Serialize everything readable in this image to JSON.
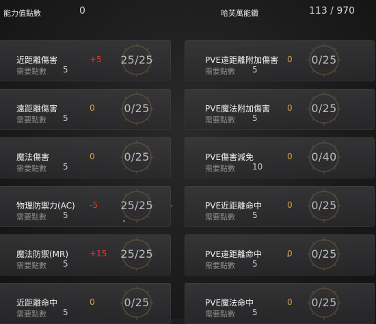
{
  "header": {
    "points_label": "能力值點數",
    "points_value": "0",
    "harvest_label": "哈芙萬能鑽",
    "harvest_value": "113 / 970"
  },
  "colors": {
    "zero": "#d4a24a",
    "positive": "#e33b2c",
    "negative": "#e33b2c"
  },
  "left_stats": [
    {
      "name": "近距離傷害",
      "cost_label": "需要點數",
      "cost": "5",
      "delta": "+5",
      "delta_type": "positive",
      "level": "25/25"
    },
    {
      "name": "遠距離傷害",
      "cost_label": "需要點數",
      "cost": "5",
      "delta": "0",
      "delta_type": "zero",
      "level": "0/25"
    },
    {
      "name": "魔法傷害",
      "cost_label": "需要點數",
      "cost": "5",
      "delta": "0",
      "delta_type": "zero",
      "level": "0/25"
    },
    {
      "name": "物理防禦力(AC)",
      "cost_label": "需要點數",
      "cost": "5",
      "delta": "-5",
      "delta_type": "negative",
      "level": "25/25"
    },
    {
      "name": "魔法防禦(MR)",
      "cost_label": "需要點數",
      "cost": "5",
      "delta": "+15",
      "delta_type": "positive",
      "level": "25/25"
    },
    {
      "name": "近距離命中",
      "cost_label": "需要點數",
      "cost": "5",
      "delta": "0",
      "delta_type": "zero",
      "level": "0/25"
    }
  ],
  "right_stats": [
    {
      "name": "PVE遠距離附加傷害",
      "cost_label": "需要點數",
      "cost": "5",
      "delta": "0",
      "delta_type": "zero",
      "level": "0/25"
    },
    {
      "name": "PVE魔法附加傷害",
      "cost_label": "需要點數",
      "cost": "5",
      "delta": "0",
      "delta_type": "zero",
      "level": "0/25"
    },
    {
      "name": "PVE傷害減免",
      "cost_label": "需要點數",
      "cost": "10",
      "delta": "0",
      "delta_type": "zero",
      "level": "0/40"
    },
    {
      "name": "PVE近距離命中",
      "cost_label": "需要點數",
      "cost": "5",
      "delta": "0",
      "delta_type": "zero",
      "level": "0/25"
    },
    {
      "name": "PVE遠距離命中",
      "cost_label": "需要點數",
      "cost": "5",
      "delta": "0",
      "delta_type": "zero",
      "level": "0/25"
    },
    {
      "name": "PVE魔法命中",
      "cost_label": "需要點數",
      "cost": "5",
      "delta": "0",
      "delta_type": "zero",
      "level": "0/25"
    }
  ]
}
